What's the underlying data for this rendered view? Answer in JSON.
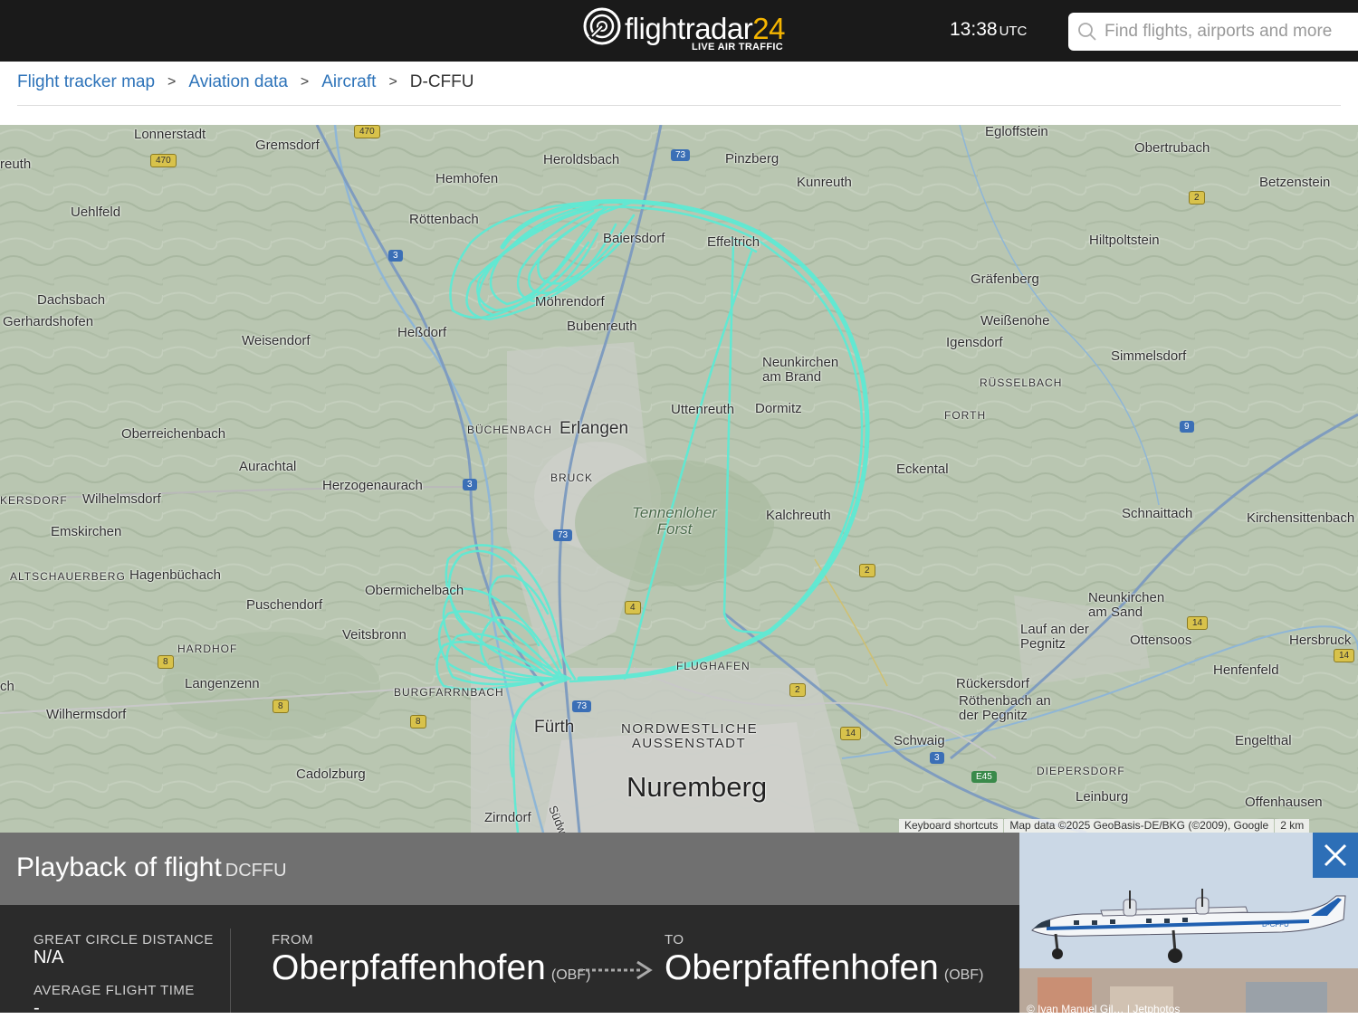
{
  "header": {
    "logo_text": "flightradar",
    "logo_num": "24",
    "logo_tagline": "LIVE AIR TRAFFIC",
    "clock_time": "13:38",
    "clock_tz": "UTC",
    "search_placeholder": "Find flights, airports and more"
  },
  "breadcrumb": {
    "items": [
      "Flight tracker map",
      "Aviation data",
      "Aircraft"
    ],
    "current": "D-CFFU",
    "separator": ">"
  },
  "map": {
    "places": [
      "Lonnerstadt",
      "Gremsdorf",
      "Heroldsbach",
      "Pinzberg",
      "Egloffstein",
      "Obertrubach",
      "reuth",
      "Hemhofen",
      "Kunreuth",
      "Betzenstein",
      "Uehlfeld",
      "Röttenbach",
      "Baiersdorf",
      "Effeltrich",
      "Hiltpoltstein",
      "Dachsbach",
      "Gerhardshofen",
      "Möhrendorf",
      "Gräfenberg",
      "Bubenreuth",
      "Weißenohe",
      "Heßdorf",
      "Weisendorf",
      "Igensdorf",
      "Simmelsdorf",
      "Neunkirchen am Brand",
      "Uttenreuth",
      "Dormitz",
      "Erlangen",
      "Oberreichenbach",
      "Aurachtal",
      "Eckental",
      "Herzogenaurach",
      "Wilhelmsdorf",
      "Emskirchen",
      "Kalchreuth",
      "Schnaittach",
      "Kirchensittenbach",
      "Hagenbüchach",
      "Obermichelbach",
      "Puschendorf",
      "Neunkirchen am Sand",
      "Veitsbronn",
      "Lauf an der Pegnitz",
      "Ottensoos",
      "Hersbruck",
      "Langenzenn",
      "Henfenfeld",
      "Rückersdorf",
      "Röthenbach an der Pegnitz",
      "ch",
      "Wilhermsdorf",
      "Fürth",
      "Schwaig",
      "Engelthal",
      "Cadolzburg",
      "Leinburg",
      "Nuremberg",
      "Offenhausen",
      "Zirndorf",
      "Südwest"
    ],
    "districts": [
      "RÜSSELBACH",
      "FORTH",
      "BÜCHENBACH",
      "BRUCK",
      "KERSDORF",
      "ALTSCHAUERBERG",
      "HARDHOF",
      "BURGFARRNBACH",
      "FLUGHAFEN",
      "NORDWESTLICHE AUSSENSTADT",
      "DIEPERSDORF"
    ],
    "forest": "Tennenloher Forst",
    "roads": [
      "470",
      "470",
      "73",
      "2",
      "3",
      "9",
      "3",
      "73",
      "2",
      "14",
      "4",
      "14",
      "73",
      "8",
      "2",
      "8",
      "8",
      "14",
      "3",
      "E45"
    ],
    "attribution": [
      "Keyboard shortcuts",
      "Map data ©2025 GeoBasis-DE/BKG (©2009), Google",
      "2 km"
    ],
    "track_color": "#5eead4"
  },
  "panel": {
    "title": "Playback of flight",
    "flight_id": "DCFFU",
    "stats": [
      {
        "label": "GREAT CIRCLE DISTANCE",
        "value": "N/A"
      },
      {
        "label": "AVERAGE FLIGHT TIME",
        "value": "-"
      }
    ],
    "from": {
      "label": "FROM",
      "city": "Oberpfaffenhofen",
      "code": "(OBF)"
    },
    "to": {
      "label": "TO",
      "city": "Oberpfaffenhofen",
      "code": "(OBF)"
    },
    "photo_credit": "© Ivan Manuel Gil… | Jetphotos",
    "aircraft_reg_on_photo": "D-CFFU"
  },
  "colors": {
    "topbar": "#1a1a1a",
    "link": "#2d73b9",
    "panel_header": "#707070",
    "panel_body": "#2b2b2b",
    "close_button": "#2d6fb7",
    "logo_accent": "#f4b400"
  }
}
